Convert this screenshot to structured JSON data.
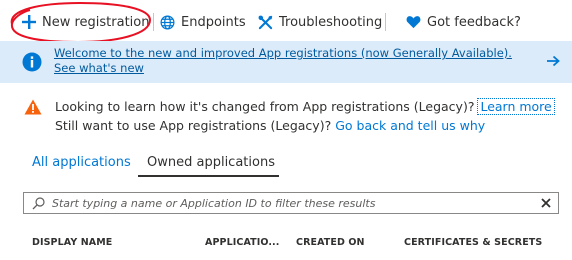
{
  "toolbar": {
    "new_registration": "New registration",
    "endpoints": "Endpoints",
    "troubleshooting": "Troubleshooting",
    "feedback": "Got feedback?"
  },
  "banner": {
    "text": "Welcome to the new and improved App registrations (now Generally Available). See what's new",
    "icon": "info-icon",
    "arrow_icon": "arrow-right-icon"
  },
  "warning": {
    "line1": "Looking to learn how it's changed from App registrations (Legacy)?",
    "learn_more": "Learn more",
    "line2": "Still want to use App registrations (Legacy)?",
    "go_back": "Go back and tell us why"
  },
  "tabs": [
    {
      "label": "All applications",
      "selected": false
    },
    {
      "label": "Owned applications",
      "selected": true
    }
  ],
  "search": {
    "placeholder": "Start typing a name or Application ID to filter these results",
    "value": ""
  },
  "columns": [
    "DISPLAY NAME",
    "APPLICATIO...",
    "CREATED ON",
    "CERTIFICATES & SECRETS"
  ],
  "colors": {
    "accent": "#0078d4",
    "banner_bg": "#dcebf9",
    "warning": "#f7630c",
    "annotation": "#e81123"
  }
}
